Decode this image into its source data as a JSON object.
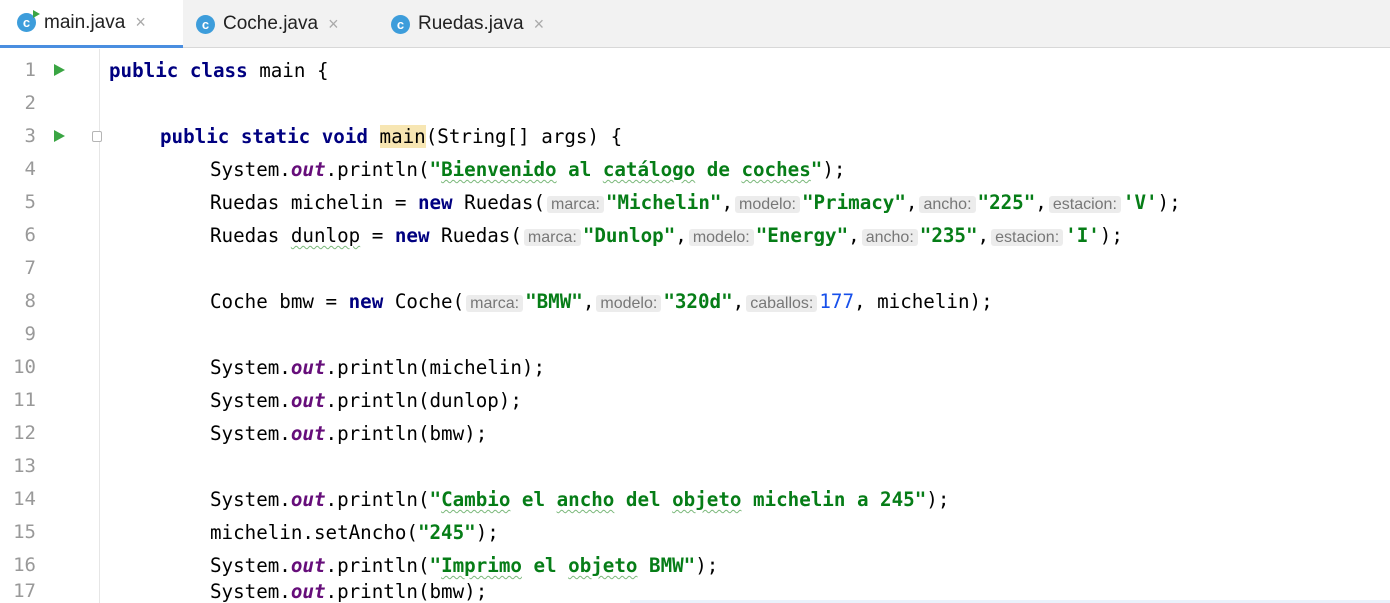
{
  "tabs": [
    {
      "name": "main.java",
      "icon": "c",
      "active": true
    },
    {
      "name": "Coche.java",
      "icon": "c",
      "active": false
    },
    {
      "name": "Ruedas.java",
      "icon": "c",
      "active": false
    }
  ],
  "close_symbol": "×",
  "line_numbers": [
    "1",
    "2",
    "3",
    "4",
    "5",
    "6",
    "7",
    "8",
    "9",
    "10",
    "11",
    "12",
    "13",
    "14",
    "15",
    "16",
    "17"
  ],
  "code": {
    "l1": {
      "kw1": "public",
      "kw2": "class",
      "name": " main {"
    },
    "l3": {
      "kw1": "public",
      "kw2": "static",
      "kw3": "void",
      "method": "main",
      "rest": "(String[] args) {"
    },
    "l4": {
      "pre": "System.",
      "out": "out",
      "mid": ".println(",
      "s1": "\"",
      "w1": "Bienvenido",
      "s2": " al ",
      "w2": "catálogo",
      "s3": " de ",
      "w3": "coches",
      "s4": "\"",
      "end": ");"
    },
    "l5": {
      "pre": "Ruedas michelin = ",
      "kw": "new",
      "call": " Ruedas(",
      "h1": "marca:",
      "v1": "\"Michelin\"",
      "c1": ",",
      "h2": "modelo:",
      "v2": "\"Primacy\"",
      "c2": ",",
      "h3": "ancho:",
      "v3": "\"225\"",
      "c3": ",",
      "h4": "estacion:",
      "v4": "'V'",
      "end": ");"
    },
    "l6": {
      "pre": "Ruedas ",
      "var": "dunlop",
      "eq": " = ",
      "kw": "new",
      "call": " Ruedas(",
      "h1": "marca:",
      "v1": "\"Dunlop\"",
      "c1": ",",
      "h2": "modelo:",
      "v2": "\"Energy\"",
      "c2": ",",
      "h3": "ancho:",
      "v3": "\"235\"",
      "c3": ",",
      "h4": "estacion:",
      "v4": "'I'",
      "end": ");"
    },
    "l8": {
      "pre": "Coche bmw = ",
      "kw": "new",
      "call": " Coche(",
      "h1": "marca:",
      "v1": "\"BMW\"",
      "c1": ",",
      "h2": "modelo:",
      "v2": "\"320d\"",
      "c2": ",",
      "h3": "caballos:",
      "v3": "177",
      "end": ", michelin);"
    },
    "l10": {
      "pre": "System.",
      "out": "out",
      "end": ".println(michelin);"
    },
    "l11": {
      "pre": "System.",
      "out": "out",
      "end": ".println(dunlop);"
    },
    "l12": {
      "pre": "System.",
      "out": "out",
      "end": ".println(bmw);"
    },
    "l14": {
      "pre": "System.",
      "out": "out",
      "mid": ".println(",
      "s1": "\"",
      "w1": "Cambio",
      "s2": " el ",
      "w2": "ancho",
      "s3": " del ",
      "w3": "objeto",
      "s4": " michelin a 245\"",
      "end": ");"
    },
    "l15": {
      "pre": "michelin.setAncho(",
      "str": "\"245\"",
      "end": ");"
    },
    "l16": {
      "pre": "System.",
      "out": "out",
      "mid": ".println(",
      "s1": "\"",
      "w1": "Imprimo",
      "s2": " el ",
      "w2": "objeto",
      "s3": " BMW\"",
      "end": ");"
    },
    "l17": {
      "pre": "System.",
      "out": "out",
      "end": ".println(bmw);"
    }
  },
  "colors": {
    "keyword": "#000080",
    "string": "#067d17",
    "number": "#1750eb",
    "field": "#660e7a",
    "run": "#3aa543",
    "file_icon": "#3d9ddb"
  }
}
